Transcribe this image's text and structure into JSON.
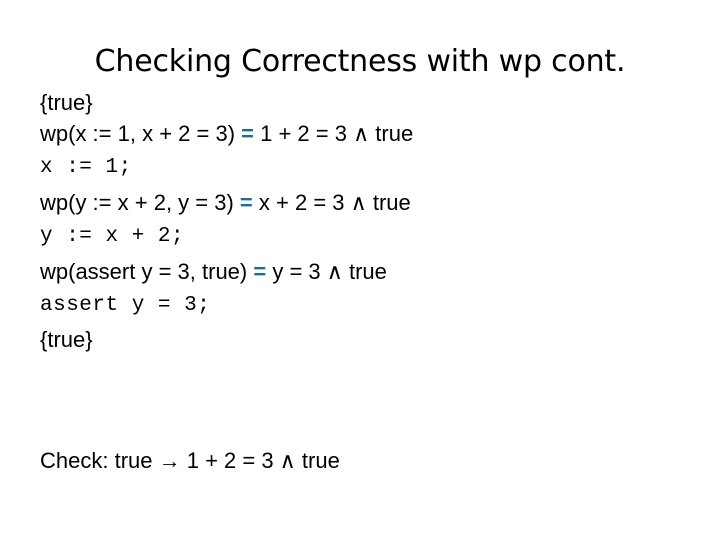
{
  "slide": {
    "title": "Checking Correctness with wp cont.",
    "accent_color": "#1B6E96",
    "text_color": "#000000",
    "background_color": "#FFFFFF",
    "lines": [
      {
        "id": "pre-assertion",
        "style": "proportional",
        "text": "{true}"
      },
      {
        "id": "wp-x-assign",
        "style": "proportional",
        "before_eq": "wp(x := 1, x + 2 = 3) ",
        "eq": "=",
        "after_eq": " 1 + 2 = 3 ∧ true"
      },
      {
        "id": "stmt-x-assign",
        "style": "monospace",
        "text": "x := 1;"
      },
      {
        "id": "wp-y-assign",
        "style": "proportional",
        "before_eq": "wp(y := x + 2, y = 3) ",
        "eq": "=",
        "after_eq": " x + 2 = 3 ∧ true"
      },
      {
        "id": "stmt-y-assign",
        "style": "monospace",
        "text": "y := x + 2;"
      },
      {
        "id": "wp-assert",
        "style": "proportional",
        "before_eq": "wp(assert y = 3, true) ",
        "eq": "=",
        "after_eq": " y = 3 ∧ true"
      },
      {
        "id": "stmt-assert",
        "style": "monospace",
        "text": "assert y = 3;"
      },
      {
        "id": "post-assertion",
        "style": "proportional",
        "text": "{true}"
      }
    ],
    "check": {
      "text": "Check: true → 1 + 2 = 3 ∧ true"
    }
  }
}
